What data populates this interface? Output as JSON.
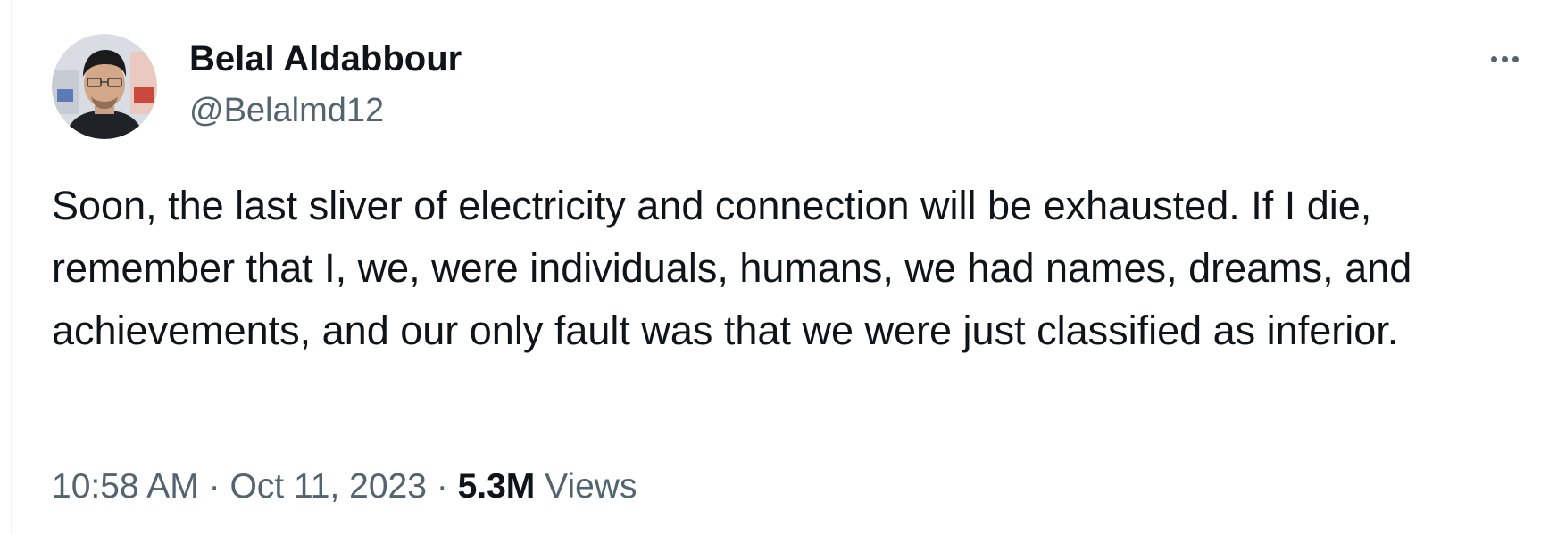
{
  "author": {
    "name": "Belal Aldabbour",
    "handle": "@Belalmd12"
  },
  "tweet": {
    "text": "Soon, the last sliver of electricity and connection will be exhausted. If I die, remember that I, we, were individuals, humans, we had names, dreams, and achievements, and our only fault was that we were just classified as inferior."
  },
  "meta": {
    "time": "10:58 AM",
    "separator": "·",
    "date": "Oct 11, 2023",
    "views_count": "5.3M",
    "views_label": "Views"
  },
  "icons": {
    "more": "more-horizontal-icon",
    "avatar": "profile-photo"
  },
  "colors": {
    "primary_text": "#0f1419",
    "secondary_text": "#536471",
    "background": "#ffffff"
  }
}
